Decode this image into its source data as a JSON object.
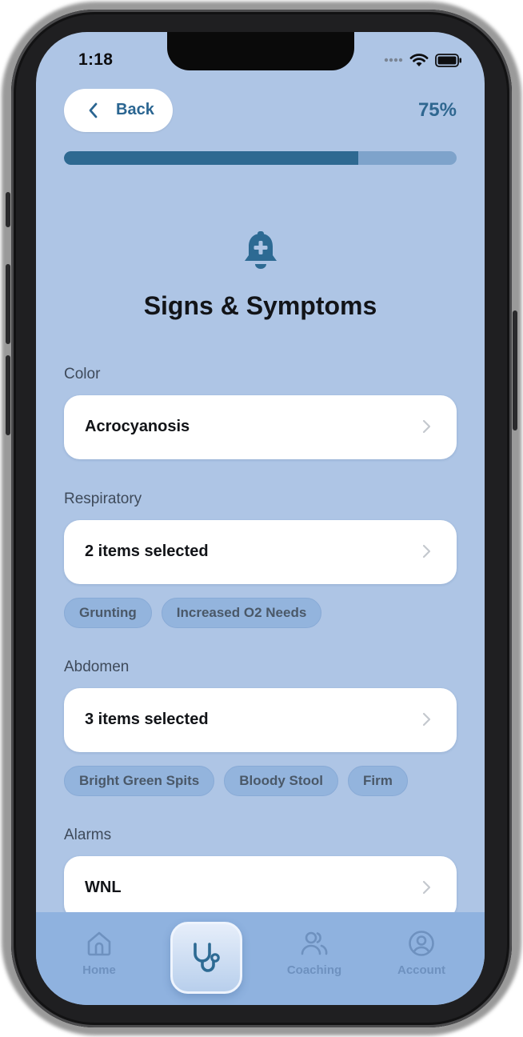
{
  "status_bar": {
    "time": "1:18"
  },
  "header": {
    "back_label": "Back",
    "progress_text": "75%",
    "progress_value": 0.75
  },
  "page": {
    "title": "Signs & Symptoms",
    "icon": "bell-plus-icon"
  },
  "sections": [
    {
      "label": "Color",
      "value": "Acrocyanosis",
      "chips": []
    },
    {
      "label": "Respiratory",
      "value": "2 items selected",
      "chips": [
        "Grunting",
        "Increased O2 Needs"
      ]
    },
    {
      "label": "Abdomen",
      "value": "3 items selected",
      "chips": [
        "Bright Green Spits",
        "Bloody Stool",
        "Firm"
      ]
    },
    {
      "label": "Alarms",
      "value": "WNL",
      "chips": []
    }
  ],
  "tabbar": {
    "items": [
      {
        "label": "Home",
        "icon": "home-icon"
      },
      {
        "label": "",
        "icon": "stethoscope-icon",
        "active": true
      },
      {
        "label": "Coaching",
        "icon": "people-icon"
      },
      {
        "label": "Account",
        "icon": "account-icon"
      }
    ]
  },
  "colors": {
    "background": "#aec5e5",
    "accent": "#2e6991",
    "chip": "#93b4dd",
    "tabbar": "#8fb2df"
  }
}
